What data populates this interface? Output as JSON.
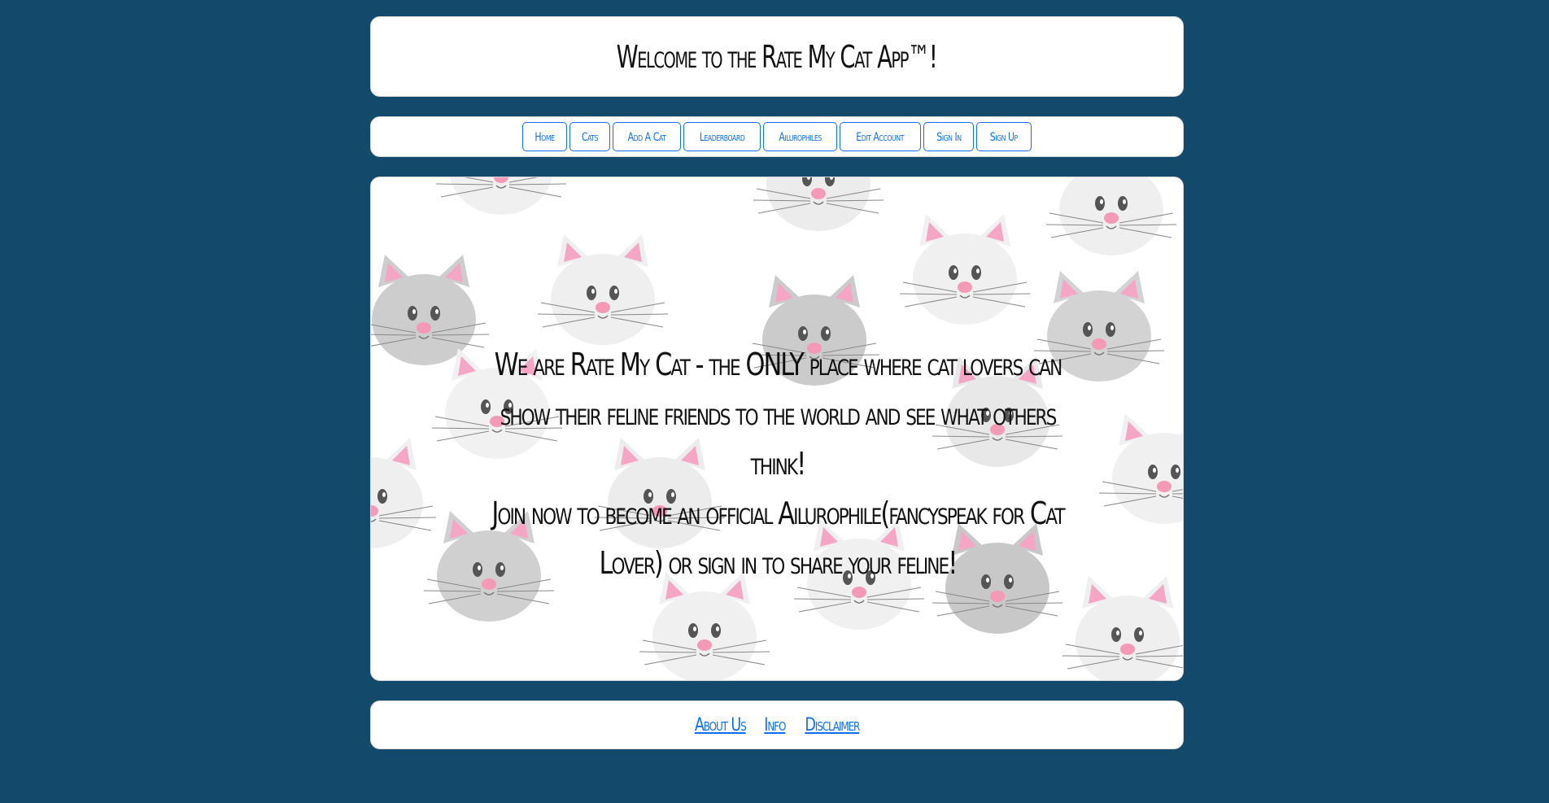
{
  "header": {
    "title": "Welcome to the Rate My Cat App™!"
  },
  "nav": {
    "items": [
      {
        "label": "Home"
      },
      {
        "label": "Cats"
      },
      {
        "label": "Add A Cat"
      },
      {
        "label": "Leaderboard"
      },
      {
        "label": "Ailurophiles"
      },
      {
        "label": "Edit Account"
      },
      {
        "label": "Sign In"
      },
      {
        "label": "Sign Up"
      }
    ]
  },
  "hero": {
    "line1": "We are Rate My Cat - the ONLY place where cat lovers can show their feline friends to the world and see what others think!",
    "line2": "Join now to become an official Ailurophile(fancyspeak for Cat Lover) or sign in to share your feline!",
    "background": "cat-pattern"
  },
  "footer": {
    "links": [
      {
        "label": "About Us"
      },
      {
        "label": "Info"
      },
      {
        "label": "Disclaimer"
      }
    ]
  },
  "colors": {
    "page_bg": "#134a6b",
    "card_bg": "#ffffff",
    "accent": "#0d6efd"
  }
}
